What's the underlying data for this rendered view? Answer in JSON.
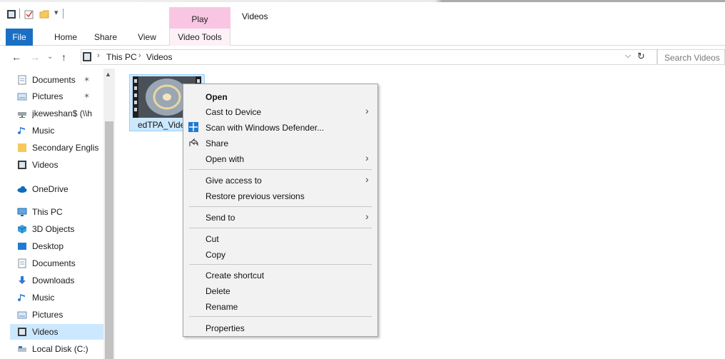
{
  "window": {
    "title": "Videos"
  },
  "ribbon": {
    "context_tab": "Play",
    "tabs": [
      "File",
      "Home",
      "Share",
      "View",
      "Video Tools"
    ]
  },
  "address_bar": {
    "crumbs": [
      "This PC",
      "Videos"
    ],
    "search_placeholder": "Search Videos"
  },
  "nav_pane": {
    "items": [
      {
        "label": "Documents",
        "icon": "documents-icon",
        "pinned": true
      },
      {
        "label": "Pictures",
        "icon": "pictures-icon",
        "pinned": true
      },
      {
        "label": "jkeweshan$ (\\\\h",
        "icon": "network-drive-icon",
        "pinned": false
      },
      {
        "label": "Music",
        "icon": "music-icon",
        "pinned": false
      },
      {
        "label": "Secondary Englis",
        "icon": "folder-icon",
        "pinned": false
      },
      {
        "label": "Videos",
        "icon": "videos-icon",
        "pinned": false
      },
      {
        "label": "OneDrive",
        "icon": "onedrive-icon",
        "pinned": false
      },
      {
        "label": "This PC",
        "icon": "this-pc-icon",
        "pinned": false
      },
      {
        "label": "3D Objects",
        "icon": "3d-objects-icon",
        "pinned": false
      },
      {
        "label": "Desktop",
        "icon": "desktop-icon",
        "pinned": false
      },
      {
        "label": "Documents",
        "icon": "documents-icon",
        "pinned": false
      },
      {
        "label": "Downloads",
        "icon": "downloads-icon",
        "pinned": false
      },
      {
        "label": "Music",
        "icon": "music-icon",
        "pinned": false
      },
      {
        "label": "Pictures",
        "icon": "pictures-icon",
        "pinned": false
      },
      {
        "label": "Videos",
        "icon": "videos-icon",
        "pinned": false,
        "selected": true
      },
      {
        "label": "Local Disk (C:)",
        "icon": "local-disk-icon",
        "pinned": false
      }
    ]
  },
  "file": {
    "name": "edTPA_Vide"
  },
  "context_menu": {
    "items": [
      {
        "label": "Open",
        "bold": true
      },
      {
        "label": "Cast to Device",
        "submenu": true
      },
      {
        "label": "Scan with Windows Defender...",
        "icon": "windows-defender-icon"
      },
      {
        "label": "Share",
        "icon": "share-icon"
      },
      {
        "label": "Open with",
        "submenu": true,
        "highlighted": true
      },
      {
        "label": "Give access to",
        "submenu": true
      },
      {
        "label": "Restore previous versions"
      },
      {
        "label": "Send to",
        "submenu": true
      },
      {
        "label": "Cut"
      },
      {
        "label": "Copy"
      },
      {
        "label": "Create shortcut"
      },
      {
        "label": "Delete"
      },
      {
        "label": "Rename"
      },
      {
        "label": "Properties"
      }
    ]
  },
  "colors": {
    "accent": "#1a6fc4",
    "context_tab": "#f8c6e3",
    "selection": "#cce8ff",
    "highlight": "#fff35a"
  }
}
